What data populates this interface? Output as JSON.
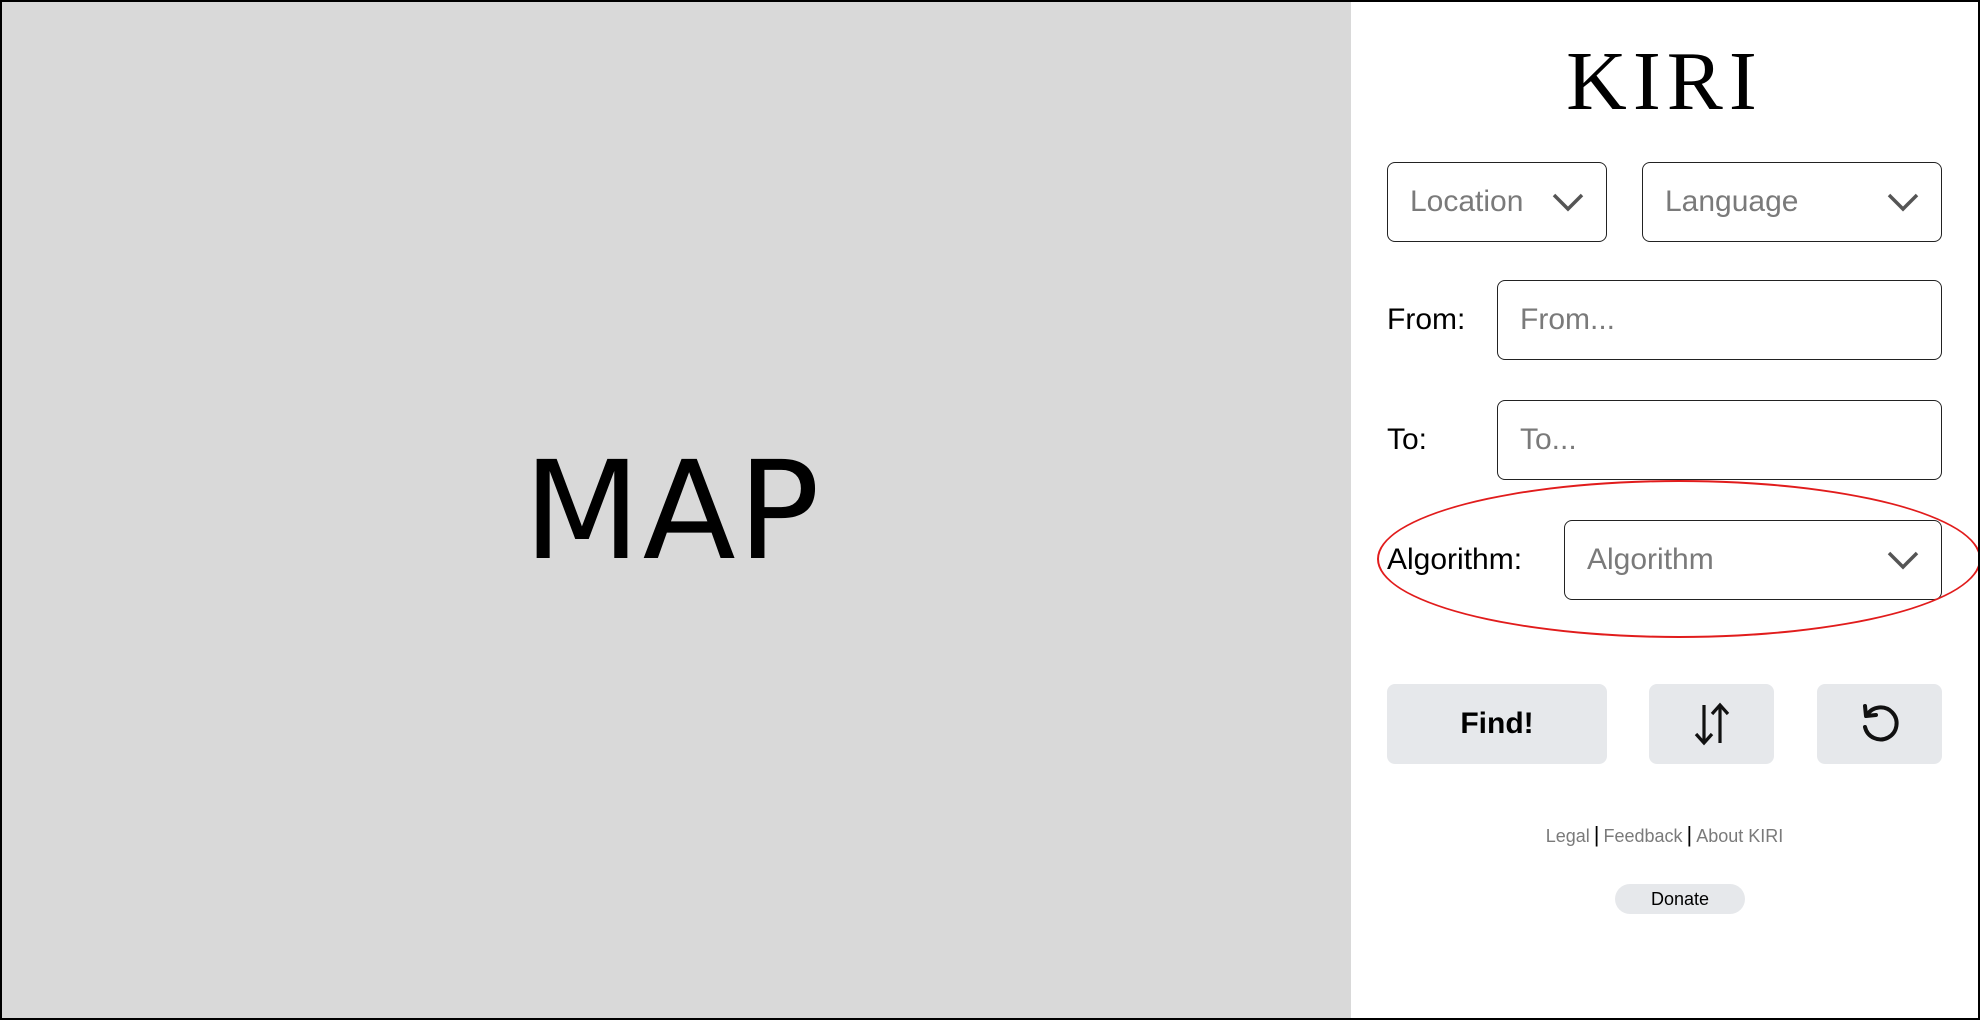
{
  "map": {
    "label": "MAP"
  },
  "header": {
    "logo": "KIRI"
  },
  "selects": {
    "location": {
      "value": "Location"
    },
    "language": {
      "value": "Language"
    },
    "algorithm": {
      "value": "Algorithm"
    }
  },
  "form": {
    "from": {
      "label": "From:",
      "placeholder": "From..."
    },
    "to": {
      "label": "To:",
      "placeholder": "To..."
    },
    "algorithm_label": "Algorithm:"
  },
  "buttons": {
    "find_label": "Find!",
    "swap_icon": "swap-vertical-icon",
    "reset_icon": "reset-icon"
  },
  "footer": {
    "links": [
      "Legal",
      "Feedback",
      "About KIRI"
    ],
    "separator": "|",
    "donate_label": "Donate"
  },
  "colors": {
    "map_bg": "#d9d9d9",
    "button_bg": "#e6e8eb",
    "highlight": "#e11c1c",
    "placeholder": "#7a7a7a"
  }
}
